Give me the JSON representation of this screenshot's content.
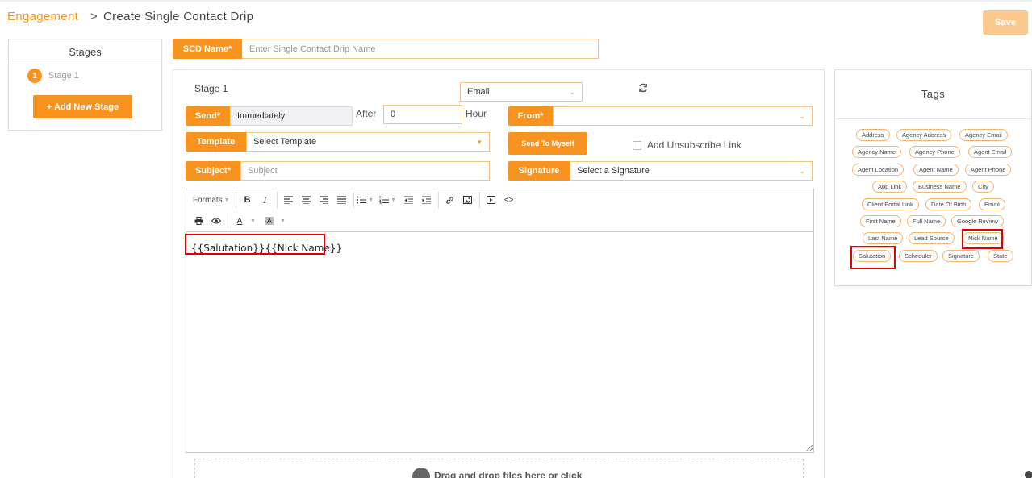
{
  "breadcrumb": {
    "parent": "Engagement",
    "separator": ">",
    "current": "Create Single Contact Drip"
  },
  "header": {
    "save_label": "Save"
  },
  "stages": {
    "title": "Stages",
    "items": [
      {
        "number": "1",
        "label": "Stage 1"
      }
    ],
    "add_button": "+ Add New Stage"
  },
  "scd": {
    "label": "SCD Name*",
    "placeholder": "Enter Single Contact Drip Name",
    "value": ""
  },
  "stage_form": {
    "title": "Stage 1",
    "channel": "Email",
    "send_label": "Send*",
    "send_value": "Immediately",
    "after_label": "After",
    "after_value": "0",
    "hour_label": "Hour",
    "from_label": "From*",
    "from_value": "",
    "template_label": "Template",
    "template_value": "Select Template",
    "send_to_myself": "Send To Myself",
    "unsubscribe_label": "Add Unsubscribe Link",
    "unsubscribe_checked": false,
    "subject_label": "Subject*",
    "subject_placeholder": "Subject",
    "signature_label": "Signature",
    "signature_value": "Select a Signature"
  },
  "editor": {
    "formats_label": "Formats",
    "content": "{{Salutation}}{{Nick Name}}"
  },
  "dropzone": {
    "text": "Drag and drop files here or click"
  },
  "tags": {
    "title": "Tags",
    "items": [
      "Address",
      "Agency Address",
      "Agency Email",
      "Agency Name",
      "Agency Phone",
      "Agent Email",
      "Agent Location",
      "Agent Name",
      "Agent Phone",
      "App Link",
      "Business Name",
      "City",
      "Client Portal Link",
      "Date Of Birth",
      "Email",
      "First Name",
      "Full Name",
      "Google Review",
      "Last Name",
      "Lead Source",
      "Nick Name",
      "Salutation",
      "Scheduler",
      "Signature",
      "State"
    ],
    "highlighted": [
      "Nick Name",
      "Salutation"
    ]
  },
  "colors": {
    "accent": "#f7931e",
    "accent_light": "#fbc98e",
    "highlight": "#e00000"
  }
}
